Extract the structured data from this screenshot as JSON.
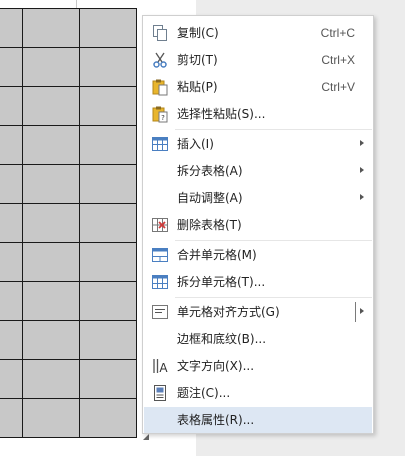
{
  "menu": {
    "items": [
      {
        "label": "复制(C)",
        "shortcut": "Ctrl+C",
        "icon": "copy-icon"
      },
      {
        "label": "剪切(T)",
        "shortcut": "Ctrl+X",
        "icon": "scissors-icon"
      },
      {
        "label": "粘贴(P)",
        "shortcut": "Ctrl+V",
        "icon": "paste-icon"
      },
      {
        "label": "选择性粘贴(S)...",
        "icon": "paste-special-icon"
      },
      {
        "label": "插入(I)",
        "icon": "table-insert-icon",
        "submenu": true
      },
      {
        "label": "拆分表格(A)",
        "submenu": true
      },
      {
        "label": "自动调整(A)",
        "submenu": true
      },
      {
        "label": "删除表格(T)",
        "icon": "delete-table-icon"
      },
      {
        "label": "合并单元格(M)",
        "icon": "merge-cells-icon"
      },
      {
        "label": "拆分单元格(T)...",
        "icon": "split-cells-icon"
      },
      {
        "label": "单元格对齐方式(G)",
        "icon": "cell-align-icon",
        "submenu": true
      },
      {
        "label": "边框和底纹(B)..."
      },
      {
        "label": "文字方向(X)...",
        "icon": "text-direction-icon"
      },
      {
        "label": "题注(C)...",
        "icon": "caption-icon"
      },
      {
        "label": "表格属性(R)...",
        "highlighted": true
      }
    ]
  },
  "colors": {
    "table_cell_fill": "#c8c8c8",
    "menu_highlight": "#dde7f3",
    "icon_blue": "#4a7fc1",
    "icon_yellow": "#e8b52c"
  }
}
